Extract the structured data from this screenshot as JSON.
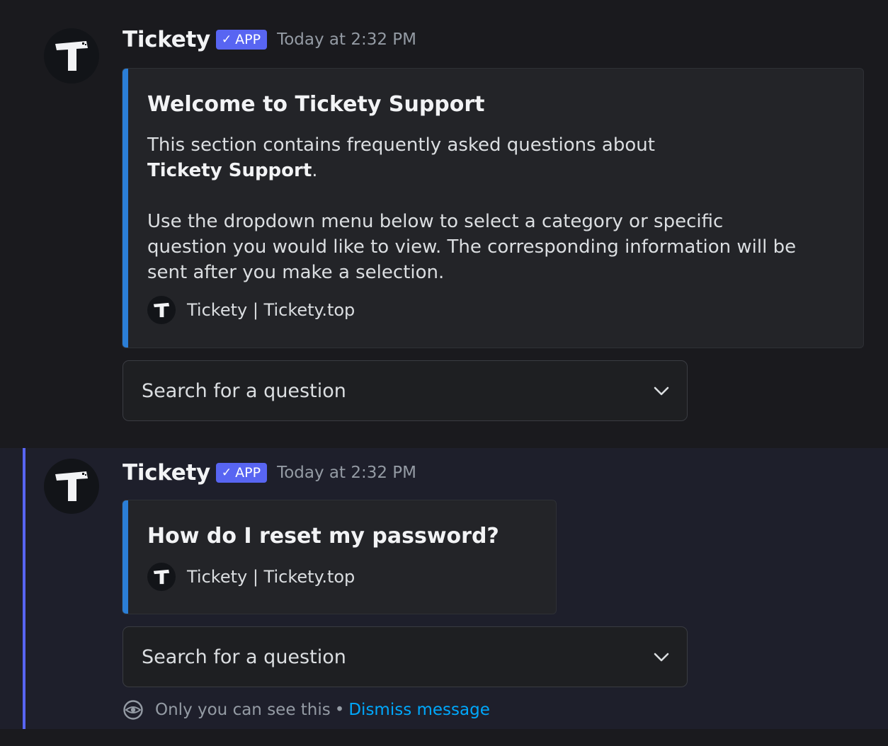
{
  "messages": [
    {
      "username": "Tickety",
      "badge": "APP",
      "badge_check": "✓",
      "timestamp": "Today at 2:32 PM",
      "embed": {
        "title": "Welcome to Tickety Support",
        "desc_line1": "This section contains frequently asked questions about",
        "desc_bold": "Tickety Support",
        "desc_after_bold": ".",
        "desc_para2": "Use the dropdown menu below to select a category or specific question you would like to view. The corresponding information will be sent after you make a selection.",
        "footer": "Tickety | Tickety.top",
        "accent_color": "#2b7ed6"
      },
      "select_placeholder": "Search for a question"
    },
    {
      "username": "Tickety",
      "badge": "APP",
      "badge_check": "✓",
      "timestamp": "Today at 2:32 PM",
      "embed": {
        "title": "How do I reset my password?",
        "footer": "Tickety | Tickety.top",
        "accent_color": "#2b7ed6"
      },
      "select_placeholder": "Search for a question",
      "ephemeral": {
        "notice": "Only you can see this",
        "separator": "•",
        "dismiss": "Dismiss message",
        "icon": "eye-icon"
      }
    }
  ],
  "colors": {
    "brand": "#5865f2",
    "link": "#00a8fc",
    "background": "#1a1a1e"
  }
}
